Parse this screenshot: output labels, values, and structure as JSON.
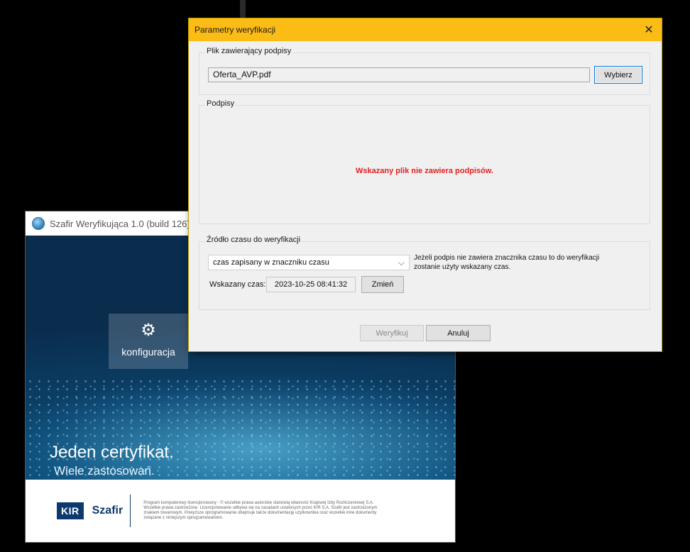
{
  "app": {
    "title": "Szafir Weryfikująca 1.0 (build 126)",
    "config_tile_label": "konfiguracja",
    "headline": "Jeden certyfikat.",
    "subheadline": "Wiele zastosowań.",
    "footer": {
      "kir_logo": "KIR",
      "szafir_logo": "Szafir",
      "legal_text": "Program komputerowy licencjonowany - © wszelkie prawa autorskie stanowią własność Krajowej Izby Rozliczeniowej S.A. Wszelkie prawa zastrzeżone. Licencjonowanie odbywa się na zasadach ustalonych przez KIR S.A. Szafir jest zastrzeżonym znakiem towarowym. Powyższe oprogramowanie obejmuje także dokumentację użytkownika oraz wszelkie inne dokumenty związane z niniejszym oprogramowaniem."
    }
  },
  "dialog": {
    "title": "Parametry weryfikacji",
    "close_glyph": "✕",
    "file_group": {
      "legend": "Plik zawierający podpisy",
      "value": "Oferta_AVP.pdf",
      "choose_label": "Wybierz"
    },
    "signatures_group": {
      "legend": "Podpisy",
      "message": "Wskazany plik nie zawiera podpisów."
    },
    "time_group": {
      "legend": "Źródło czasu do weryfikacji",
      "select_value": "czas zapisany w znaczniku czasu",
      "hint": "Jeżeli podpis nie zawiera znacznika czasu to do weryfikacji zostanie użyty wskazany czas.",
      "time_label": "Wskazany czas:",
      "time_value": "2023-10-25 08:41:32",
      "change_label": "Zmień"
    },
    "verify_label": "Weryfikuj",
    "cancel_label": "Anuluj"
  },
  "colors": {
    "dialog_titlebar": "#fcbc16",
    "error_text": "#e32222",
    "brand_navy": "#0d3a6e"
  },
  "icons": [
    "app-logo-icon",
    "gear-icon",
    "close-icon",
    "chevron-down-icon"
  ]
}
